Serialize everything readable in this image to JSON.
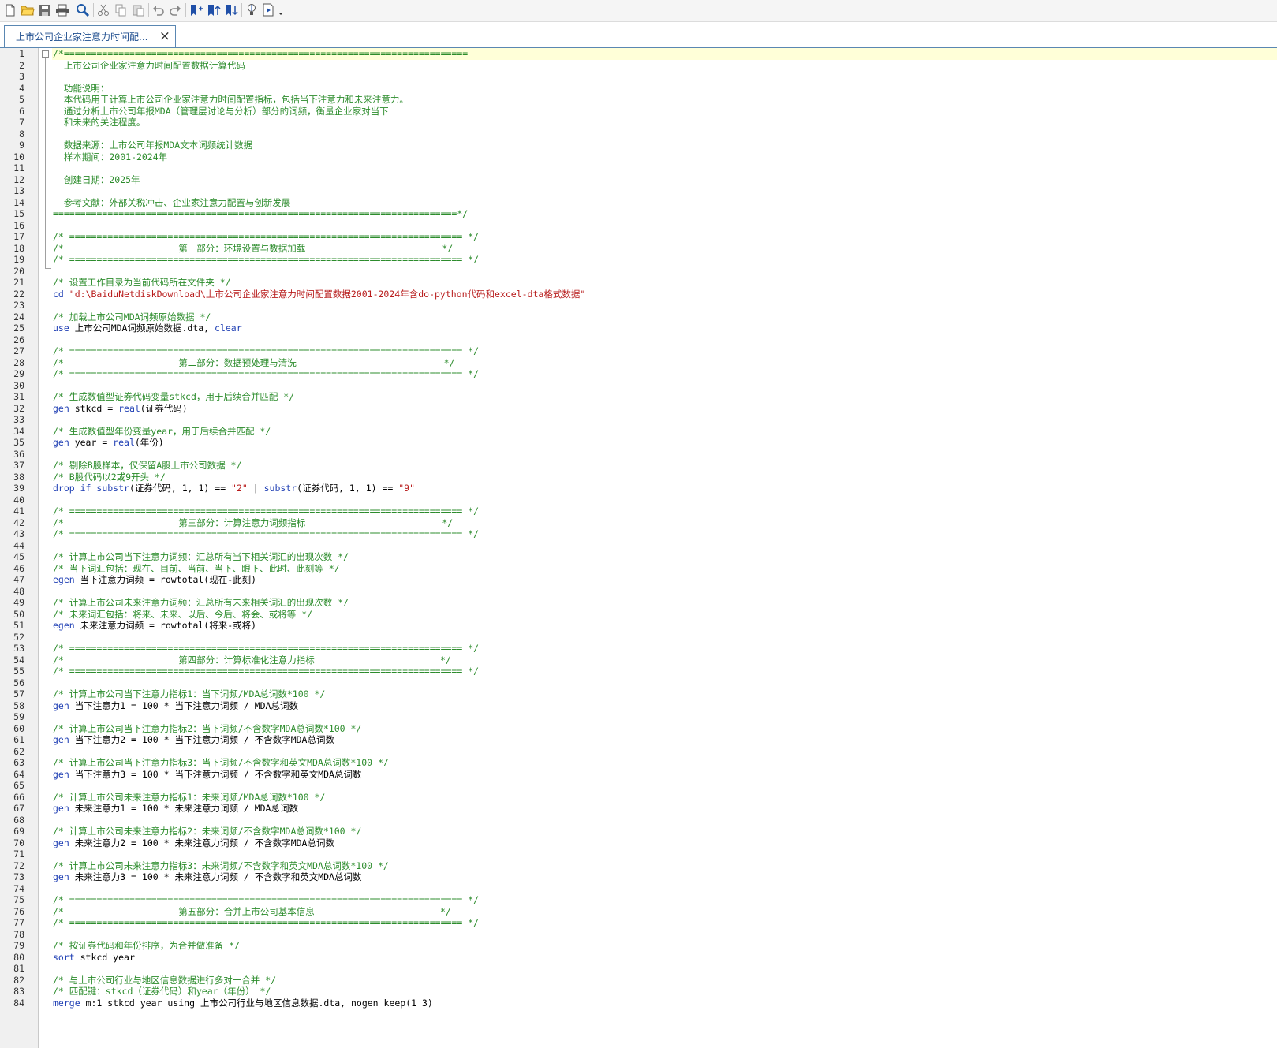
{
  "toolbar": {
    "buttons": [
      {
        "icon": "new-file-icon"
      },
      {
        "icon": "open-folder-icon"
      },
      {
        "icon": "save-icon"
      },
      {
        "icon": "print-icon"
      },
      {
        "icon": "find-icon"
      },
      {
        "icon": "cut-icon"
      },
      {
        "icon": "copy-icon"
      },
      {
        "icon": "paste-icon"
      },
      {
        "icon": "undo-icon"
      },
      {
        "icon": "redo-icon"
      },
      {
        "icon": "toggle-bookmark-icon"
      },
      {
        "icon": "previous-bookmark-icon"
      },
      {
        "icon": "next-bookmark-icon"
      },
      {
        "icon": "show-code-icon"
      },
      {
        "icon": "execute-do-icon"
      }
    ]
  },
  "tab": {
    "label": "上市公司企业家注意力时间配...",
    "close": "×"
  },
  "colors": {
    "comment": "#2c8c2c",
    "keyword": "#1f3fb4",
    "string": "#b81c1c",
    "tab_border": "#5a87b2"
  },
  "lines": [
    {
      "n": "1",
      "t": [
        {
          "c": "c",
          "v": "/*=========================================================================="
        }
      ]
    },
    {
      "n": "2",
      "t": [
        {
          "c": "c",
          "v": "  上市公司企业家注意力时间配置数据计算代码"
        }
      ]
    },
    {
      "n": "3",
      "t": []
    },
    {
      "n": "4",
      "t": [
        {
          "c": "c",
          "v": "  功能说明："
        }
      ]
    },
    {
      "n": "5",
      "t": [
        {
          "c": "c",
          "v": "  本代码用于计算上市公司企业家注意力时间配置指标，包括当下注意力和未来注意力。"
        }
      ]
    },
    {
      "n": "6",
      "t": [
        {
          "c": "c",
          "v": "  通过分析上市公司年报MDA（管理层讨论与分析）部分的词频，衡量企业家对当下"
        }
      ]
    },
    {
      "n": "7",
      "t": [
        {
          "c": "c",
          "v": "  和未来的关注程度。"
        }
      ]
    },
    {
      "n": "8",
      "t": []
    },
    {
      "n": "9",
      "t": [
        {
          "c": "c",
          "v": "  数据来源：上市公司年报MDA文本词频统计数据"
        }
      ]
    },
    {
      "n": "10",
      "t": [
        {
          "c": "c",
          "v": "  样本期间：2001-2024年"
        }
      ]
    },
    {
      "n": "11",
      "t": []
    },
    {
      "n": "12",
      "t": [
        {
          "c": "c",
          "v": "  创建日期：2025年"
        }
      ]
    },
    {
      "n": "13",
      "t": []
    },
    {
      "n": "14",
      "t": [
        {
          "c": "c",
          "v": "  参考文献：外部关税冲击、企业家注意力配置与创新发展"
        }
      ]
    },
    {
      "n": "15",
      "t": [
        {
          "c": "c",
          "v": "==========================================================================*/"
        }
      ]
    },
    {
      "n": "16",
      "t": []
    },
    {
      "n": "17",
      "t": [
        {
          "c": "c",
          "v": "/* ======================================================================== */"
        }
      ]
    },
    {
      "n": "18",
      "t": [
        {
          "c": "c",
          "v": "/*                     第一部分：环境设置与数据加载                         */"
        }
      ]
    },
    {
      "n": "19",
      "t": [
        {
          "c": "c",
          "v": "/* ======================================================================== */"
        }
      ]
    },
    {
      "n": "20",
      "t": []
    },
    {
      "n": "21",
      "t": [
        {
          "c": "c",
          "v": "/* 设置工作目录为当前代码所在文件夹 */"
        }
      ]
    },
    {
      "n": "22",
      "t": [
        {
          "c": "k",
          "v": "cd"
        },
        {
          "c": "",
          "v": " "
        },
        {
          "c": "s",
          "v": "\"d:\\BaiduNetdiskDownload\\上市公司企业家注意力时间配置数据2001-2024年含do-python代码和excel-dta格式数据\""
        }
      ]
    },
    {
      "n": "23",
      "t": []
    },
    {
      "n": "24",
      "t": [
        {
          "c": "c",
          "v": "/* 加载上市公司MDA词频原始数据 */"
        }
      ]
    },
    {
      "n": "25",
      "t": [
        {
          "c": "k",
          "v": "use"
        },
        {
          "c": "",
          "v": " 上市公司MDA词频原始数据.dta, "
        },
        {
          "c": "k",
          "v": "clear"
        }
      ]
    },
    {
      "n": "26",
      "t": []
    },
    {
      "n": "27",
      "t": [
        {
          "c": "c",
          "v": "/* ======================================================================== */"
        }
      ]
    },
    {
      "n": "28",
      "t": [
        {
          "c": "c",
          "v": "/*                     第二部分：数据预处理与清洗                           */"
        }
      ]
    },
    {
      "n": "29",
      "t": [
        {
          "c": "c",
          "v": "/* ======================================================================== */"
        }
      ]
    },
    {
      "n": "30",
      "t": []
    },
    {
      "n": "31",
      "t": [
        {
          "c": "c",
          "v": "/* 生成数值型证券代码变量stkcd，用于后续合并匹配 */"
        }
      ]
    },
    {
      "n": "32",
      "t": [
        {
          "c": "k",
          "v": "gen"
        },
        {
          "c": "",
          "v": " stkcd = "
        },
        {
          "c": "k",
          "v": "real"
        },
        {
          "c": "",
          "v": "(证券代码)"
        }
      ]
    },
    {
      "n": "33",
      "t": []
    },
    {
      "n": "34",
      "t": [
        {
          "c": "c",
          "v": "/* 生成数值型年份变量year，用于后续合并匹配 */"
        }
      ]
    },
    {
      "n": "35",
      "t": [
        {
          "c": "k",
          "v": "gen"
        },
        {
          "c": "",
          "v": " year = "
        },
        {
          "c": "k",
          "v": "real"
        },
        {
          "c": "",
          "v": "(年份)"
        }
      ]
    },
    {
      "n": "36",
      "t": []
    },
    {
      "n": "37",
      "t": [
        {
          "c": "c",
          "v": "/* 剔除B股样本，仅保留A股上市公司数据 */"
        }
      ]
    },
    {
      "n": "38",
      "t": [
        {
          "c": "c",
          "v": "/* B股代码以2或9开头 */"
        }
      ]
    },
    {
      "n": "39",
      "t": [
        {
          "c": "k",
          "v": "drop if"
        },
        {
          "c": "",
          "v": " "
        },
        {
          "c": "k",
          "v": "substr"
        },
        {
          "c": "",
          "v": "(证券代码, 1, 1) == "
        },
        {
          "c": "s",
          "v": "\"2\""
        },
        {
          "c": "",
          "v": " | "
        },
        {
          "c": "k",
          "v": "substr"
        },
        {
          "c": "",
          "v": "(证券代码, 1, 1) == "
        },
        {
          "c": "s",
          "v": "\"9\""
        }
      ]
    },
    {
      "n": "40",
      "t": []
    },
    {
      "n": "41",
      "t": [
        {
          "c": "c",
          "v": "/* ======================================================================== */"
        }
      ]
    },
    {
      "n": "42",
      "t": [
        {
          "c": "c",
          "v": "/*                     第三部分：计算注意力词频指标                         */"
        }
      ]
    },
    {
      "n": "43",
      "t": [
        {
          "c": "c",
          "v": "/* ======================================================================== */"
        }
      ]
    },
    {
      "n": "44",
      "t": []
    },
    {
      "n": "45",
      "t": [
        {
          "c": "c",
          "v": "/* 计算上市公司当下注意力词频：汇总所有当下相关词汇的出现次数 */"
        }
      ]
    },
    {
      "n": "46",
      "t": [
        {
          "c": "c",
          "v": "/* 当下词汇包括：现在、目前、当前、当下、眼下、此时、此刻等 */"
        }
      ]
    },
    {
      "n": "47",
      "t": [
        {
          "c": "k",
          "v": "egen"
        },
        {
          "c": "",
          "v": " 当下注意力词频 = rowtotal(现在-此刻)"
        }
      ]
    },
    {
      "n": "48",
      "t": []
    },
    {
      "n": "49",
      "t": [
        {
          "c": "c",
          "v": "/* 计算上市公司未来注意力词频：汇总所有未来相关词汇的出现次数 */"
        }
      ]
    },
    {
      "n": "50",
      "t": [
        {
          "c": "c",
          "v": "/* 未来词汇包括：将来、未来、以后、今后、将会、或将等 */"
        }
      ]
    },
    {
      "n": "51",
      "t": [
        {
          "c": "k",
          "v": "egen"
        },
        {
          "c": "",
          "v": " 未来注意力词频 = rowtotal(将来-或将)"
        }
      ]
    },
    {
      "n": "52",
      "t": []
    },
    {
      "n": "53",
      "t": [
        {
          "c": "c",
          "v": "/* ======================================================================== */"
        }
      ]
    },
    {
      "n": "54",
      "t": [
        {
          "c": "c",
          "v": "/*                     第四部分：计算标准化注意力指标                       */"
        }
      ]
    },
    {
      "n": "55",
      "t": [
        {
          "c": "c",
          "v": "/* ======================================================================== */"
        }
      ]
    },
    {
      "n": "56",
      "t": []
    },
    {
      "n": "57",
      "t": [
        {
          "c": "c",
          "v": "/* 计算上市公司当下注意力指标1：当下词频/MDA总词数*100 */"
        }
      ]
    },
    {
      "n": "58",
      "t": [
        {
          "c": "k",
          "v": "gen"
        },
        {
          "c": "",
          "v": " 当下注意力1 = 100 * 当下注意力词频 / MDA总词数"
        }
      ]
    },
    {
      "n": "59",
      "t": []
    },
    {
      "n": "60",
      "t": [
        {
          "c": "c",
          "v": "/* 计算上市公司当下注意力指标2：当下词频/不含数字MDA总词数*100 */"
        }
      ]
    },
    {
      "n": "61",
      "t": [
        {
          "c": "k",
          "v": "gen"
        },
        {
          "c": "",
          "v": " 当下注意力2 = 100 * 当下注意力词频 / 不含数字MDA总词数"
        }
      ]
    },
    {
      "n": "62",
      "t": []
    },
    {
      "n": "63",
      "t": [
        {
          "c": "c",
          "v": "/* 计算上市公司当下注意力指标3：当下词频/不含数字和英文MDA总词数*100 */"
        }
      ]
    },
    {
      "n": "64",
      "t": [
        {
          "c": "k",
          "v": "gen"
        },
        {
          "c": "",
          "v": " 当下注意力3 = 100 * 当下注意力词频 / 不含数字和英文MDA总词数"
        }
      ]
    },
    {
      "n": "65",
      "t": []
    },
    {
      "n": "66",
      "t": [
        {
          "c": "c",
          "v": "/* 计算上市公司未来注意力指标1：未来词频/MDA总词数*100 */"
        }
      ]
    },
    {
      "n": "67",
      "t": [
        {
          "c": "k",
          "v": "gen"
        },
        {
          "c": "",
          "v": " 未来注意力1 = 100 * 未来注意力词频 / MDA总词数"
        }
      ]
    },
    {
      "n": "68",
      "t": []
    },
    {
      "n": "69",
      "t": [
        {
          "c": "c",
          "v": "/* 计算上市公司未来注意力指标2：未来词频/不含数字MDA总词数*100 */"
        }
      ]
    },
    {
      "n": "70",
      "t": [
        {
          "c": "k",
          "v": "gen"
        },
        {
          "c": "",
          "v": " 未来注意力2 = 100 * 未来注意力词频 / 不含数字MDA总词数"
        }
      ]
    },
    {
      "n": "71",
      "t": []
    },
    {
      "n": "72",
      "t": [
        {
          "c": "c",
          "v": "/* 计算上市公司未来注意力指标3：未来词频/不含数字和英文MDA总词数*100 */"
        }
      ]
    },
    {
      "n": "73",
      "t": [
        {
          "c": "k",
          "v": "gen"
        },
        {
          "c": "",
          "v": " 未来注意力3 = 100 * 未来注意力词频 / 不含数字和英文MDA总词数"
        }
      ]
    },
    {
      "n": "74",
      "t": []
    },
    {
      "n": "75",
      "t": [
        {
          "c": "c",
          "v": "/* ======================================================================== */"
        }
      ]
    },
    {
      "n": "76",
      "t": [
        {
          "c": "c",
          "v": "/*                     第五部分：合并上市公司基本信息                       */"
        }
      ]
    },
    {
      "n": "77",
      "t": [
        {
          "c": "c",
          "v": "/* ======================================================================== */"
        }
      ]
    },
    {
      "n": "78",
      "t": []
    },
    {
      "n": "79",
      "t": [
        {
          "c": "c",
          "v": "/* 按证券代码和年份排序，为合并做准备 */"
        }
      ]
    },
    {
      "n": "80",
      "t": [
        {
          "c": "k",
          "v": "sort"
        },
        {
          "c": "",
          "v": " stkcd year"
        }
      ]
    },
    {
      "n": "81",
      "t": []
    },
    {
      "n": "82",
      "t": [
        {
          "c": "c",
          "v": "/* 与上市公司行业与地区信息数据进行多对一合并 */"
        }
      ]
    },
    {
      "n": "83",
      "t": [
        {
          "c": "c",
          "v": "/* 匹配键：stkcd（证券代码）和year（年份） */"
        }
      ]
    },
    {
      "n": "84",
      "t": [
        {
          "c": "k",
          "v": "merge"
        },
        {
          "c": "",
          "v": " m:1 stkcd year using 上市公司行业与地区信息数据.dta, nogen keep(1 3)"
        }
      ]
    }
  ]
}
